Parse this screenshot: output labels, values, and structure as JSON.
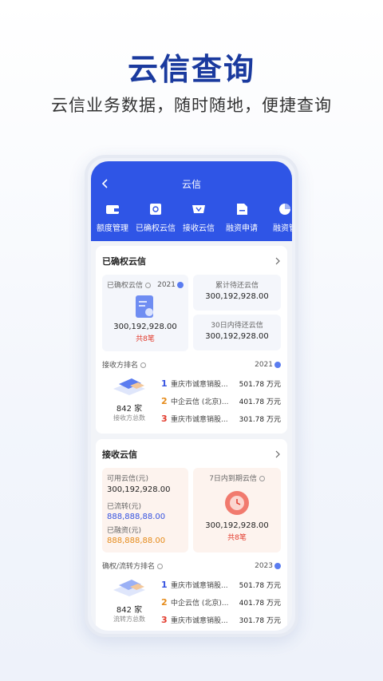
{
  "hero": {
    "title": "云信查询",
    "subtitle": "云信业务数据，随时随地，便捷查询"
  },
  "topbar": {
    "title": "云信",
    "back_icon": "chevron-left-icon"
  },
  "nav": [
    {
      "label": "额度管理",
      "icon": "wallet-icon"
    },
    {
      "label": "已确权云信",
      "icon": "search-doc-icon"
    },
    {
      "label": "接收云信",
      "icon": "receive-icon"
    },
    {
      "label": "融资申请",
      "icon": "doc-icon"
    },
    {
      "label": "融资管",
      "icon": "pie-icon"
    }
  ],
  "confirmed": {
    "title": "已确权云信",
    "left_label": "已确权云信",
    "left_year": "2021",
    "left_value": "300,192,928.00",
    "left_count": "共8笔",
    "right1_label": "累计待还云信",
    "right1_value": "300,192,928.00",
    "right2_label": "30日内待还云信",
    "right2_value": "300,192,928.00",
    "rank_title": "接收方排名",
    "rank_year": "2021",
    "count": "842 家",
    "count_sub": "接收方总数",
    "ranks": [
      {
        "no": "1",
        "name": "重庆市诚意销股...",
        "value": "501.78 万元"
      },
      {
        "no": "2",
        "name": "中企云信 (北京)...",
        "value": "401.78 万元"
      },
      {
        "no": "3",
        "name": "重庆市诚意销股...",
        "value": "301.78 万元"
      }
    ]
  },
  "received": {
    "title": "接收云信",
    "avail_label": "可用云信(元)",
    "avail_value": "300,192,928.00",
    "flow_label": "已流转(元)",
    "flow_value": "888,888,88.00",
    "fin_label": "已融资(元)",
    "fin_value": "888,888,88.00",
    "due_label": "7日内到期云信",
    "due_value": "300,192,928.00",
    "due_count": "共8笔",
    "rank_title": "确权/流转方排名",
    "rank_year": "2023",
    "count": "842 家",
    "count_sub": "流转方总数",
    "ranks": [
      {
        "no": "1",
        "name": "重庆市诚意销股...",
        "value": "501.78 万元"
      },
      {
        "no": "2",
        "name": "中企云信 (北京)...",
        "value": "401.78 万元"
      },
      {
        "no": "3",
        "name": "重庆市诚意销股...",
        "value": "301.78 万元"
      }
    ]
  },
  "colors": {
    "brand": "#2f55e6",
    "rank1": "#3552e0",
    "rank2": "#e58b1a",
    "rank3": "#e23a2c"
  }
}
